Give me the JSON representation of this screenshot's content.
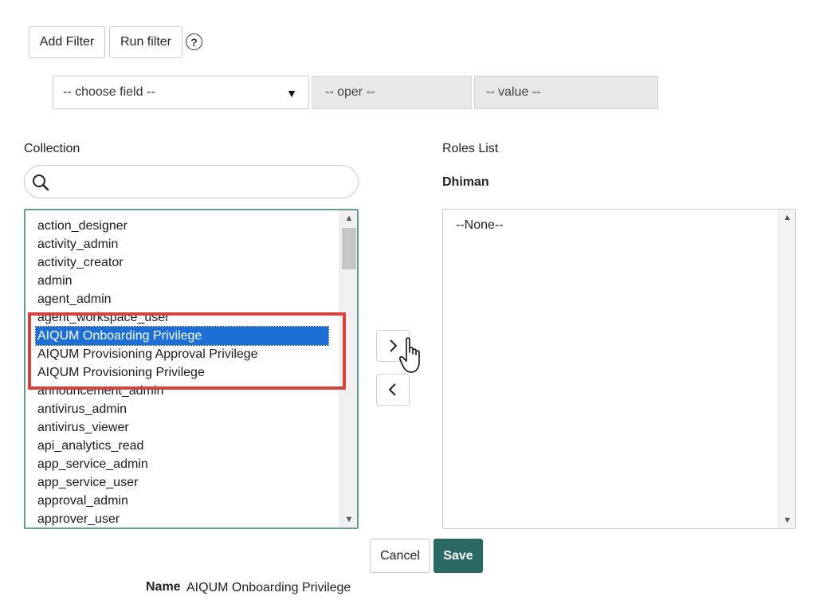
{
  "filter": {
    "add_filter_label": "Add Filter",
    "run_filter_label": "Run filter",
    "help_symbol": "?",
    "choose_field": "-- choose field --",
    "oper": "-- oper --",
    "value": "-- value --"
  },
  "collection": {
    "label": "Collection",
    "search_placeholder": "",
    "items": [
      "action_designer",
      "activity_admin",
      "activity_creator",
      "admin",
      "agent_admin",
      "agent_workspace_user",
      "AIQUM Onboarding Privilege",
      "AIQUM Provisioning Approval Privilege",
      "AIQUM Provisioning Privilege",
      "announcement_admin",
      "antivirus_admin",
      "antivirus_viewer",
      "api_analytics_read",
      "app_service_admin",
      "app_service_user",
      "approval_admin",
      "approver_user"
    ],
    "selected_index": 6
  },
  "roles": {
    "label": "Roles List",
    "user": "Dhiman",
    "empty_text": "--None--"
  },
  "actions": {
    "move_right_icon": "chevron-right",
    "move_left_icon": "chevron-left",
    "cancel_label": "Cancel",
    "save_label": "Save"
  },
  "detail": {
    "name_label": "Name",
    "name_value": "AIQUM Onboarding Privilege"
  },
  "colors": {
    "selection": "#1d6fd6",
    "highlight_box": "#d9413c",
    "save_button": "#2b6a62",
    "list_focus_border": "#6a9a8f"
  }
}
